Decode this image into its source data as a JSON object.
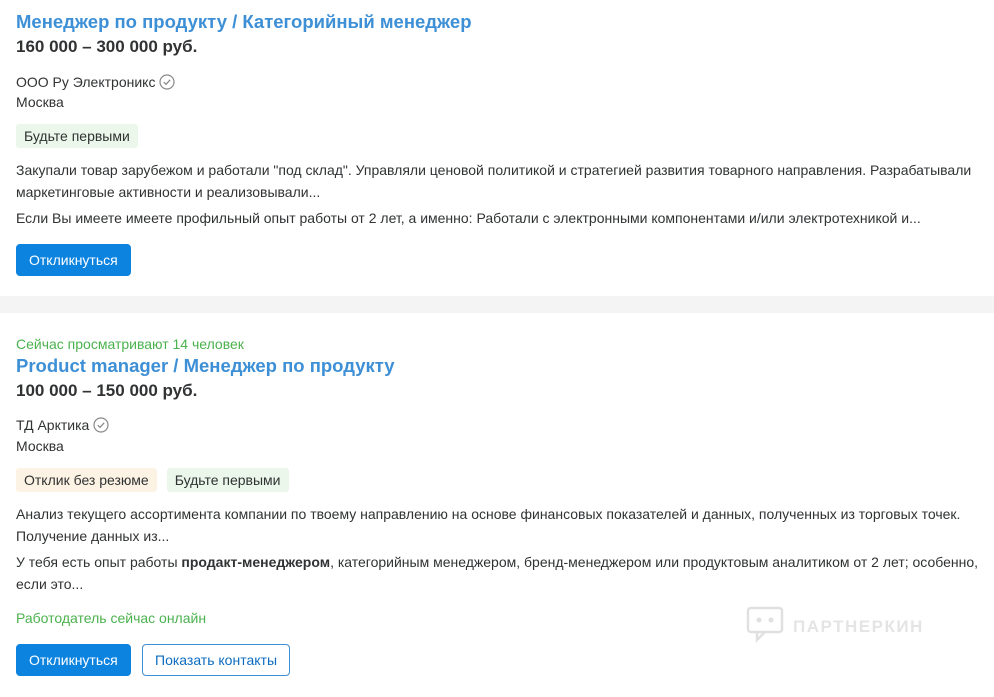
{
  "colors": {
    "title": "#3d8fd6",
    "status_green": "#4bb24e",
    "primary_button": "#0d83e0",
    "tag_green": "#eaf7ea",
    "tag_orange": "#fdf3e4"
  },
  "vacancies": [
    {
      "title": "Менеджер по продукту / Категорийный менеджер",
      "salary": "160 000 – 300 000 руб.",
      "company": "ООО Ру Электроникс",
      "verified_icon": "verified-check-icon",
      "city": "Москва",
      "tags": [
        "Будьте первыми"
      ],
      "description_1": "Закупали товар зарубежом и работали \"под склад\". Управляли ценовой политикой и стратегией развития товарного направления. Разрабатывали маркетинговые активности и реализовывали...",
      "description_2": "Если Вы имеете имеете профильный опыт работы от 2 лет, а именно: Работали с электронными компонентами и/или электротехникой и...",
      "respond_label": "Откликнуться"
    },
    {
      "viewing_now": "Сейчас просматривают 14 человек",
      "title": "Product manager / Менеджер по продукту",
      "salary": "100 000 – 150 000 руб.",
      "company": "ТД Арктика",
      "verified_icon": "verified-check-icon",
      "city": "Москва",
      "tags": [
        "Отклик без резюме",
        "Будьте первыми"
      ],
      "description_1": "Анализ текущего ассортимента компании по твоему направлению на основе финансовых показателей и данных, полученных из торговых точек. Получение данных из...",
      "description_2_before": "У тебя есть опыт работы ",
      "description_2_bold": "продакт-менеджером",
      "description_2_after": ", категорийным менеджером, бренд-менеджером или продуктовым аналитиком от 2 лет; особенно, если это...",
      "employer_online": "Работодатель сейчас онлайн",
      "respond_label": "Откликнуться",
      "contacts_label": "Показать контакты"
    }
  ],
  "watermark": {
    "text": "ПАРТНЕРКИН",
    "icon": "chat-bubble-icon"
  }
}
